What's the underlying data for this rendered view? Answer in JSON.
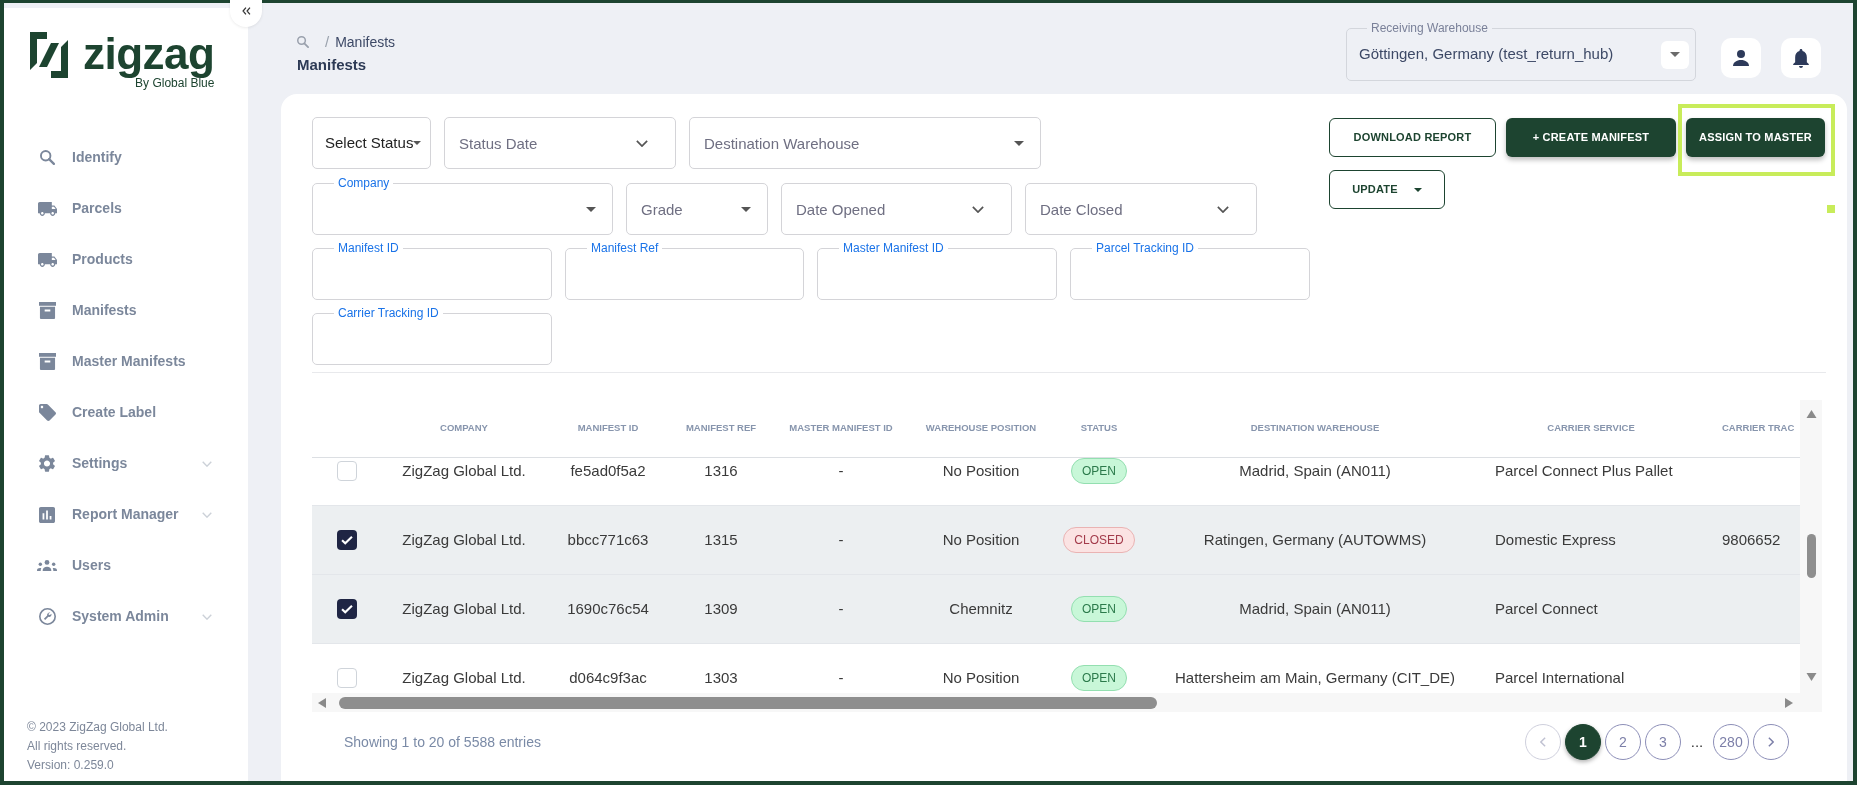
{
  "logo": {
    "wordmark": "zigzag",
    "tagline": "By Global Blue"
  },
  "nav_items": [
    {
      "label": "Identify",
      "expandable": false
    },
    {
      "label": "Parcels",
      "expandable": false
    },
    {
      "label": "Products",
      "expandable": false
    },
    {
      "label": "Manifests",
      "expandable": false
    },
    {
      "label": "Master Manifests",
      "expandable": false
    },
    {
      "label": "Create Label",
      "expandable": false
    },
    {
      "label": "Settings",
      "expandable": true
    },
    {
      "label": "Report Manager",
      "expandable": true
    },
    {
      "label": "Users",
      "expandable": false
    },
    {
      "label": "System Admin",
      "expandable": true
    }
  ],
  "footer": [
    "© 2023 ZigZag Global Ltd.",
    "All rights reserved.",
    "Version: 0.259.0"
  ],
  "header": {
    "breadcrumb": {
      "separator": "/",
      "items": [
        "Manifests"
      ]
    },
    "title": "Manifests",
    "warehouse_select": {
      "label": "Receiving Warehouse",
      "value": "Göttingen, Germany (test_return_hub)"
    }
  },
  "filter_rows": [
    {
      "fields": [
        {
          "kind": "status_menu",
          "label": "Select Status"
        },
        {
          "kind": "date",
          "placeholder": "Status Date"
        },
        {
          "kind": "select",
          "placeholder": "Destination Warehouse"
        }
      ]
    },
    {
      "fields": [
        {
          "kind": "labeled_select",
          "label": "Company"
        },
        {
          "kind": "select",
          "placeholder": "Grade"
        },
        {
          "kind": "date",
          "placeholder": "Date Opened"
        },
        {
          "kind": "date",
          "placeholder": "Date Closed"
        }
      ]
    },
    {
      "fields": [
        {
          "kind": "text",
          "label": "Manifest ID"
        },
        {
          "kind": "text",
          "label": "Manifest Ref"
        },
        {
          "kind": "text",
          "label": "Master Manifest ID"
        },
        {
          "kind": "text",
          "label": "Parcel Tracking ID"
        }
      ]
    },
    {
      "fields": [
        {
          "kind": "text",
          "label": "Carrier Tracking ID"
        }
      ]
    }
  ],
  "actions": [
    {
      "label": "DOWNLOAD REPORT",
      "kind": "outline",
      "highlighted": false
    },
    {
      "label": "+ CREATE MANIFEST",
      "kind": "filled",
      "highlighted": false
    },
    {
      "label": "ASSIGN TO MASTER",
      "kind": "filled",
      "highlighted": true
    },
    {
      "label": "UPDATE",
      "kind": "menu",
      "highlighted": false
    }
  ],
  "table": {
    "columns": [
      "COMPANY",
      "MANIFEST ID",
      "MANIFEST REF",
      "MASTER MANIFEST ID",
      "WAREHOUSE POSITION",
      "STATUS",
      "DESTINATION WAREHOUSE",
      "CARRIER SERVICE",
      "CARRIER TRAC"
    ],
    "rows": [
      {
        "selected": false,
        "company": "ZigZag Global Ltd.",
        "manifest_id": "fe5ad0f5a2",
        "manifest_ref": "1316",
        "master_manifest_id": "-",
        "warehouse_position": "No Position",
        "status": {
          "label": "OPEN",
          "kind": "open"
        },
        "destination_warehouse": "Madrid, Spain (AN011)",
        "carrier_service": "Parcel Connect Plus Pallet"
      },
      {
        "selected": true,
        "company": "ZigZag Global Ltd.",
        "manifest_id": "bbcc771c63",
        "manifest_ref": "1315",
        "master_manifest_id": "-",
        "warehouse_position": "No Position",
        "status": {
          "label": "CLOSED",
          "kind": "closed"
        },
        "destination_warehouse": "Ratingen, Germany (AUTOWMS)",
        "carrier_service": "Domestic Express",
        "column_10": "9806652"
      },
      {
        "selected": true,
        "company": "ZigZag Global Ltd.",
        "manifest_id": "1690c76c54",
        "manifest_ref": "1309",
        "master_manifest_id": "-",
        "warehouse_position": "Chemnitz",
        "status": {
          "label": "OPEN",
          "kind": "open"
        },
        "destination_warehouse": "Madrid, Spain (AN011)",
        "carrier_service": "Parcel Connect"
      },
      {
        "selected": false,
        "company": "ZigZag Global Ltd.",
        "manifest_id": "d064c9f3ac",
        "manifest_ref": "1303",
        "master_manifest_id": "-",
        "warehouse_position": "No Position",
        "status": {
          "label": "OPEN",
          "kind": "open"
        },
        "destination_warehouse": "Hattersheim am Main, Germany (CIT_DE)",
        "carrier_service": "Parcel International"
      }
    ],
    "summary": "Showing 1 to 20 of 5588 entries"
  },
  "pagination": {
    "previous": {
      "disabled": true
    },
    "pages": [
      {
        "label": "1",
        "selected": true
      },
      {
        "label": "2",
        "selected": false
      },
      {
        "label": "3",
        "selected": false
      }
    ],
    "ellipsis": "...",
    "last_page": {
      "label": "280",
      "selected": false
    },
    "next": {
      "disabled": false
    }
  }
}
